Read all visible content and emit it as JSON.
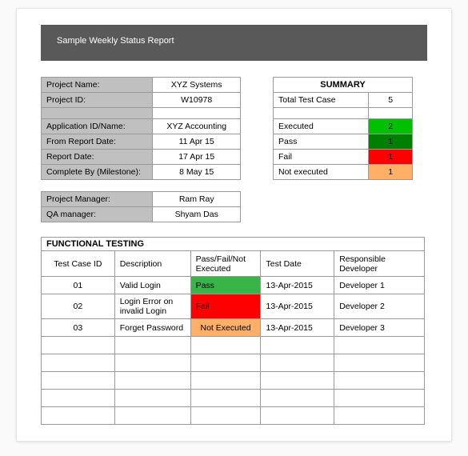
{
  "title": "Sample Weekly Status Report",
  "project_info": {
    "project_name_label": "Project Name:",
    "project_name_value": "XYZ Systems",
    "project_id_label": "Project ID:",
    "project_id_value": "W10978",
    "app_id_label": "Application ID/Name:",
    "app_id_value": "XYZ Accounting",
    "from_date_label": "From Report Date:",
    "from_date_value": "11 Apr 15",
    "report_date_label": "Report Date:",
    "report_date_value": "17 Apr 15",
    "complete_by_label": "Complete By (Milestone):",
    "complete_by_value": "8 May 15"
  },
  "managers": {
    "pm_label": "Project Manager:",
    "pm_value": "Ram Ray",
    "qa_label": "QA manager:",
    "qa_value": "Shyam Das"
  },
  "summary": {
    "heading": "SUMMARY",
    "total_label": "Total Test Case",
    "total_value": "5",
    "executed_label": "Executed",
    "executed_value": "2",
    "pass_label": "Pass",
    "pass_value": "1",
    "fail_label": "Fail",
    "fail_value": "1",
    "notexec_label": "Not executed",
    "notexec_value": "1"
  },
  "functional": {
    "heading": "FUNCTIONAL TESTING",
    "cols": {
      "tc": "Test Case ID",
      "desc": "Description",
      "result": "Pass/Fail/Not Executed",
      "date": "Test Date",
      "dev": "Responsible Developer"
    },
    "rows": [
      {
        "id": "01",
        "desc": "Valid Login",
        "result": "Pass",
        "result_class": "c-green",
        "date": "13-Apr-2015",
        "dev": "Developer 1"
      },
      {
        "id": "02",
        "desc": "Login Error on invalid Login",
        "result": "Fail",
        "result_class": "c-redtext",
        "date": "13-Apr-2015",
        "dev": "Developer 2"
      },
      {
        "id": "03",
        "desc": "Forget Password",
        "result": "Not Executed",
        "result_class": "c-orange",
        "date": "13-Apr-2015",
        "dev": "Developer 3"
      }
    ],
    "blank_rows": 5
  }
}
